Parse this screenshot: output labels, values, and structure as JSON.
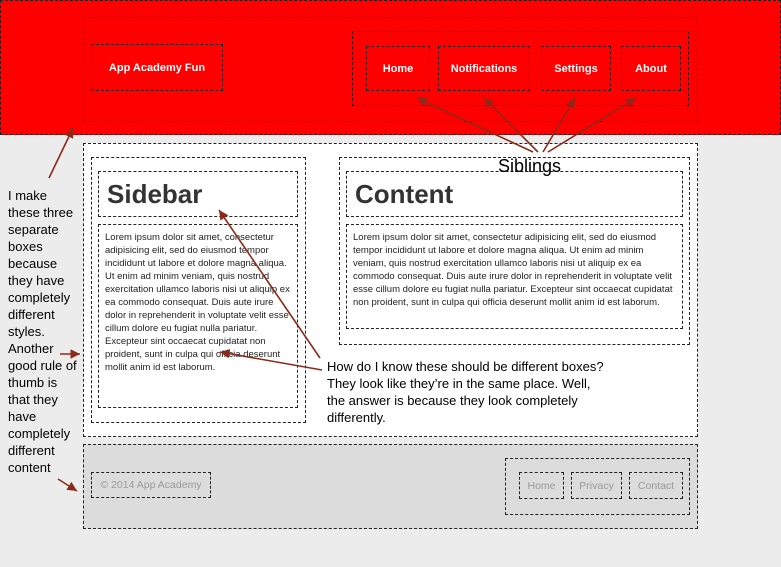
{
  "header": {
    "logo": "App Academy Fun",
    "nav": [
      "Home",
      "Notifications",
      "Settings",
      "About"
    ]
  },
  "sidebar": {
    "title": "Sidebar",
    "text": "Lorem ipsum dolor sit amet, consectetur adipisicing elit, sed do eiusmod tempor incididunt ut labore et dolore magna aliqua. Ut enim ad minim veniam, quis nostrud exercitation ullamco laboris nisi ut aliquip ex ea commodo consequat. Duis aute irure dolor in reprehenderit in voluptate velit esse cillum dolore eu fugiat nulla pariatur. Excepteur sint occaecat cupidatat non proident, sunt in culpa qui officia deserunt mollit anim id est laborum."
  },
  "content": {
    "title": "Content",
    "text": "Lorem ipsum dolor sit amet, consectetur adipisicing elit, sed do eiusmod tempor incididunt ut labore et dolore magna aliqua. Ut enim ad minim veniam, quis nostrud exercitation ullamco laboris nisi ut aliquip ex ea commodo consequat. Duis aute irure dolor in reprehenderit in voluptate velit esse cillum dolore eu fugiat nulla pariatur. Excepteur sint occaecat cupidatat non proident, sunt in culpa qui officia deserunt mollit anim id est laborum."
  },
  "footer": {
    "copyright": "© 2014 App Academy",
    "links": [
      "Home",
      "Privacy",
      "Contact"
    ]
  },
  "annotations": {
    "siblings": "Siblings",
    "left_note": "I make these three separate boxes because they have completely different styles. Another good rule of thumb is that they have completely different content",
    "middle_note": "How do I know these should be different boxes? They look like they’re in the same place. Well, the answer is because they look completely differently."
  },
  "colors": {
    "header": "#ff0000",
    "page": "#ececec",
    "footer": "#dcdcdc",
    "arrow": "#8b2a1a"
  }
}
